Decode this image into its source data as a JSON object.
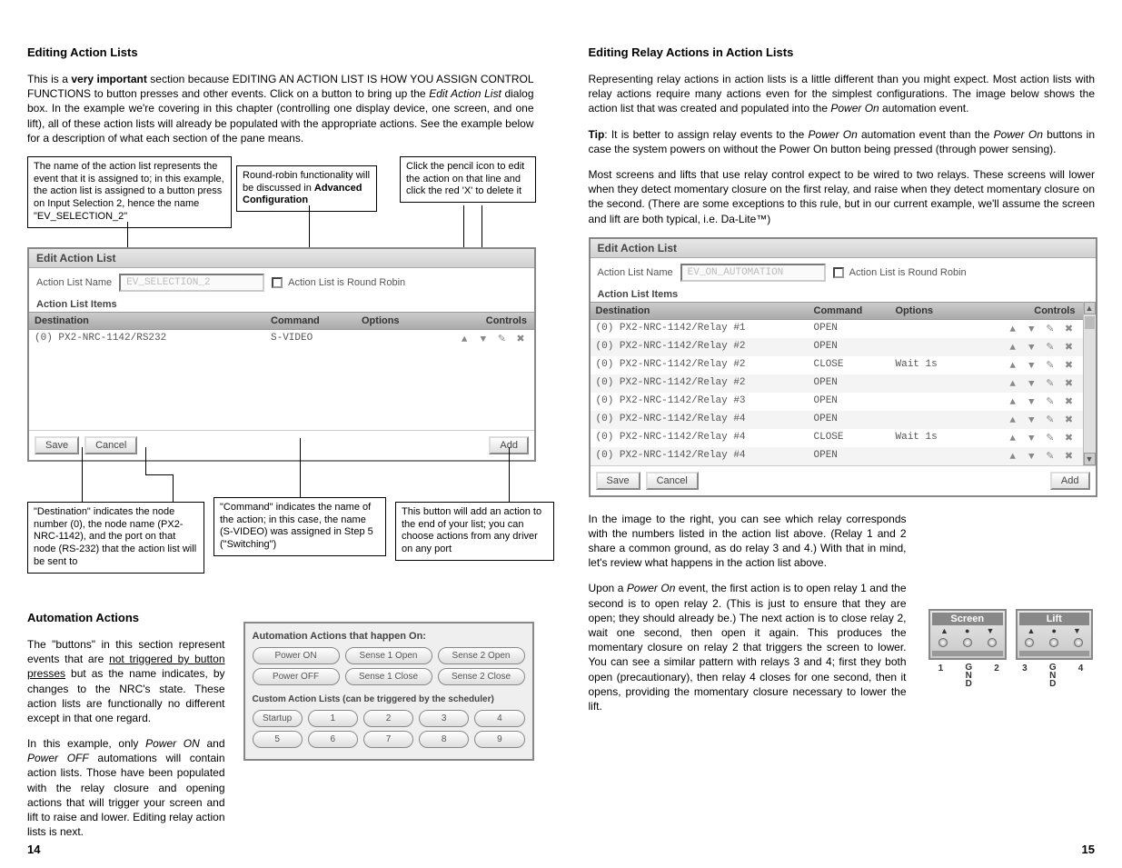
{
  "left": {
    "h1": "Editing Action Lists",
    "p1a": "This is a ",
    "p1b": "very important",
    "p1c": " section because EDITING AN ACTION LIST IS HOW YOU ASSIGN CONTROL FUNCTIONS to button presses and other events. Click on a button to bring up the ",
    "p1d": "Edit Action List",
    "p1e": " dialog box. In the example we're covering in this chapter (controlling one display device, one screen, and one lift), all of these action lists will already be populated with the appropriate actions. See the example below for a description of what each section of the pane means.",
    "callout1": "The name of the action list represents the event that it is assigned to; in this example, the action list is assigned to a button press on Input Selection 2, hence the name \"EV_SELECTION_2\"",
    "callout2a": "Round-robin functionality will be discussed in ",
    "callout2b": "Advanced Configuration",
    "callout3": "Click the pencil icon to edit the action on that line and click the red 'X' to delete it",
    "callout4": "\"Destination\" indicates the node number (0), the node name (PX2-NRC-1142), and the port on that node (RS-232) that the action list will be sent to",
    "callout5": "\"Command\" indicates the name of the action; in this case, the name (S-VIDEO) was assigned in Step 5 (\"Switching\")",
    "callout6": "This button will add an action to the end of your list; you can choose actions from any driver on any port",
    "eal": {
      "title": "Edit Action List",
      "name_label": "Action List Name",
      "name_value": "EV_SELECTION_2",
      "rr_label": "Action List is Round Robin",
      "items_label": "Action List Items",
      "hdr_dest": "Destination",
      "hdr_cmd": "Command",
      "hdr_opt": "Options",
      "hdr_ctrl": "Controls",
      "row_dest": "(0) PX2-NRC-1142/RS232",
      "row_cmd": "S-VIDEO",
      "save": "Save",
      "cancel": "Cancel",
      "add": "Add"
    },
    "h2": "Automation Actions",
    "p2a": "The \"buttons\" in this section represent events that are ",
    "p2b": "not triggered by button presses",
    "p2c": " but as the name indicates, by changes to the NRC's state. These action lists are functionally no different except in that one regard.",
    "p3a": "In this example, only ",
    "p3b": "Power ON",
    "p3c": " and ",
    "p3d": "Power OFF",
    "p3e": " automations will contain action lists. Those have been populated with the relay closure and opening actions that will trigger your screen and lift to raise and lower. Editing relay action lists is next.",
    "auto": {
      "title": "Automation Actions that happen On:",
      "b1": "Power ON",
      "b2": "Sense 1 Open",
      "b3": "Sense 2 Open",
      "b4": "Power OFF",
      "b5": "Sense 1 Close",
      "b6": "Sense 2 Close",
      "subtitle": "Custom Action Lists (can be triggered by the scheduler)",
      "c0": "Startup",
      "c1": "1",
      "c2": "2",
      "c3": "3",
      "c4": "4",
      "c5": "5",
      "c6": "6",
      "c7": "7",
      "c8": "8",
      "c9": "9"
    },
    "pagenum": "14"
  },
  "right": {
    "h1": "Editing Relay Actions in Action Lists",
    "p1": "Representing relay actions in action lists is a little different than you might expect. Most action lists with relay actions require many actions even for the simplest configurations. The image below shows the action list that was created and populated into the ",
    "p1i": "Power On",
    "p1b": " automation event.",
    "p2a": "Tip",
    "p2b": ": It is better to assign relay events to the ",
    "p2c": "Power On",
    "p2d": " automation event than the ",
    "p2e": "Power On",
    "p2f": " buttons in case the system powers on without the Power On button being pressed (through power sensing).",
    "p3": "Most screens and lifts that use relay control expect to be wired to two relays. These screens will lower when they detect momentary closure on the first relay, and raise when they detect momentary closure on the second. (There are some exceptions to this rule, but in our current example, we'll assume the screen and lift are both typical, i.e. Da-Lite™)",
    "eal": {
      "title": "Edit Action List",
      "name_label": "Action List Name",
      "name_value": "EV_ON_AUTOMATION",
      "rr_label": "Action List is Round Robin",
      "items_label": "Action List Items",
      "hdr_dest": "Destination",
      "hdr_cmd": "Command",
      "hdr_opt": "Options",
      "hdr_ctrl": "Controls",
      "rows": [
        {
          "dest": "(0) PX2-NRC-1142/Relay #1",
          "cmd": "OPEN",
          "opt": ""
        },
        {
          "dest": "(0) PX2-NRC-1142/Relay #2",
          "cmd": "OPEN",
          "opt": ""
        },
        {
          "dest": "(0) PX2-NRC-1142/Relay #2",
          "cmd": "CLOSE",
          "opt": "Wait 1s"
        },
        {
          "dest": "(0) PX2-NRC-1142/Relay #2",
          "cmd": "OPEN",
          "opt": ""
        },
        {
          "dest": "(0) PX2-NRC-1142/Relay #3",
          "cmd": "OPEN",
          "opt": ""
        },
        {
          "dest": "(0) PX2-NRC-1142/Relay #4",
          "cmd": "OPEN",
          "opt": ""
        },
        {
          "dest": "(0) PX2-NRC-1142/Relay #4",
          "cmd": "CLOSE",
          "opt": "Wait 1s"
        },
        {
          "dest": "(0) PX2-NRC-1142/Relay #4",
          "cmd": "OPEN",
          "opt": ""
        }
      ],
      "save": "Save",
      "cancel": "Cancel",
      "add": "Add"
    },
    "p4": "In the image to the right, you can see which relay corresponds with the numbers listed in the action list above. (Relay 1 and 2 share a common ground, as do relay 3 and 4.) With that in mind, let's review what happens in the action list above.",
    "p5a": "Upon a ",
    "p5b": "Power On",
    "p5c": " event, the first action is to open relay 1 and the second is to open relay 2. (This is just to ensure that they are open; they should already be.) The next action is to close relay 2, wait one second, then open it again. This produces the momentary closure on relay 2 that triggers the screen to lower. You can see a similar pattern with relays 3 and 4; first they both open (precautionary), then relay 4 closes for one second, then it opens, providing the momentary closure necessary to lower the lift.",
    "relay": {
      "screen": "Screen",
      "lift": "Lift",
      "l1": "1",
      "lg1": "G\nN\nD",
      "l2": "2",
      "l3": "3",
      "lg2": "G\nN\nD",
      "l4": "4"
    },
    "pagenum": "15"
  }
}
